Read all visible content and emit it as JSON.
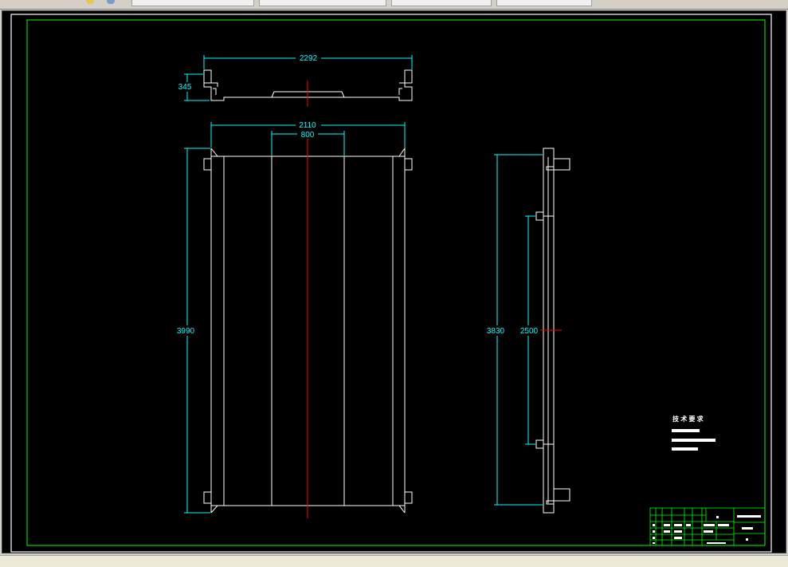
{
  "toolbar": {
    "tabs": [
      "",
      "",
      "",
      ""
    ],
    "icons": [
      "layers-icon",
      "properties-icon"
    ]
  },
  "drawing": {
    "dimensions": {
      "top_width": "2292",
      "top_height": "345",
      "front_width": "2110",
      "front_inner": "800",
      "front_height": "3990",
      "side_height": "3830",
      "side_inner": "2500"
    },
    "tech_requirements_title": "技 术 要 求"
  },
  "colors": {
    "background": "#000000",
    "frame": "#00ff00",
    "outline": "#ffffff",
    "dimension": "#00ffff",
    "centerline": "#ff0000"
  }
}
